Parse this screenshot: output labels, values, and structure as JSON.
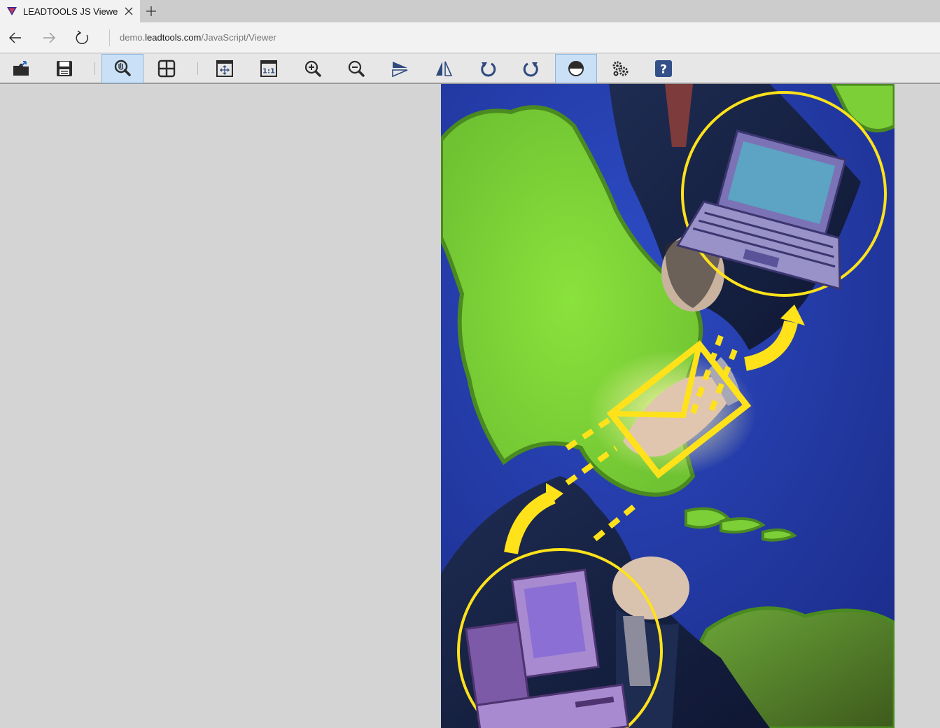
{
  "browser": {
    "tab_title": "LEADTOOLS JS Viewer Demo",
    "address_host": "demo.leadtools.com",
    "address_prefix": "demo.",
    "address_domain": "leadtools.com",
    "address_path": "/JavaScript/Viewer"
  },
  "toolbar": {
    "tools": [
      {
        "name": "open-button",
        "icon": "open-folder-icon"
      },
      {
        "name": "save-button",
        "icon": "save-icon"
      },
      {
        "name": "pan-zoom-button",
        "icon": "magnify-hand-icon",
        "active": true
      },
      {
        "name": "grid-button",
        "icon": "grid-icon"
      },
      {
        "name": "fit-page-button",
        "icon": "fit-page-icon"
      },
      {
        "name": "actual-size-button",
        "icon": "actual-size-icon"
      },
      {
        "name": "zoom-in-button",
        "icon": "zoom-in-icon"
      },
      {
        "name": "zoom-out-button",
        "icon": "zoom-out-icon"
      },
      {
        "name": "flip-button",
        "icon": "flip-icon"
      },
      {
        "name": "reverse-button",
        "icon": "reverse-icon"
      },
      {
        "name": "rotate-left-button",
        "icon": "rotate-ccw-icon"
      },
      {
        "name": "rotate-right-button",
        "icon": "rotate-cw-icon"
      },
      {
        "name": "invert-button",
        "icon": "invert-icon",
        "active": true
      },
      {
        "name": "settings-button",
        "icon": "gears-icon"
      },
      {
        "name": "help-button",
        "icon": "help-icon"
      }
    ],
    "actual_size_label": "1:1",
    "help_label": "?"
  },
  "colors": {
    "accent_active": "#c9e0f7",
    "icon_dark": "#2b2b2b",
    "icon_blue": "#2e4a7d",
    "image_ocean": "#243a9c",
    "image_land": "#86d63a",
    "image_highlight": "#ffe21a"
  }
}
